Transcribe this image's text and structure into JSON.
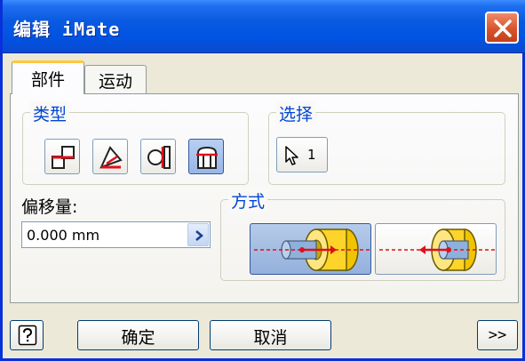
{
  "window": {
    "title": "编辑 iMate"
  },
  "tabs": [
    {
      "label": "部件",
      "active": true
    },
    {
      "label": "运动",
      "active": false
    }
  ],
  "type_group": {
    "label": "类型",
    "buttons": [
      {
        "icon": "mate-icon",
        "selected": false
      },
      {
        "icon": "angle-icon",
        "selected": false
      },
      {
        "icon": "tangent-icon",
        "selected": false
      },
      {
        "icon": "insert-icon",
        "selected": true
      }
    ]
  },
  "select_group": {
    "label": "选择",
    "count": "1",
    "icon": "cursor-arrow-icon"
  },
  "offset": {
    "label": "偏移量:",
    "value": "0.000 mm"
  },
  "mode_group": {
    "label": "方式",
    "options": [
      {
        "icon": "opposed-insert-icon",
        "selected": true
      },
      {
        "icon": "aligned-insert-icon",
        "selected": false
      }
    ]
  },
  "footer": {
    "help_icon": "help-icon",
    "ok_label": "确定",
    "cancel_label": "取消",
    "expand_label": ">>"
  },
  "colors": {
    "title_bar": "#0054e3",
    "group_label": "#0046d5",
    "close_button": "#d8542c",
    "accent_yellow": "#ffd42a",
    "arrow_red": "#e0101a"
  }
}
